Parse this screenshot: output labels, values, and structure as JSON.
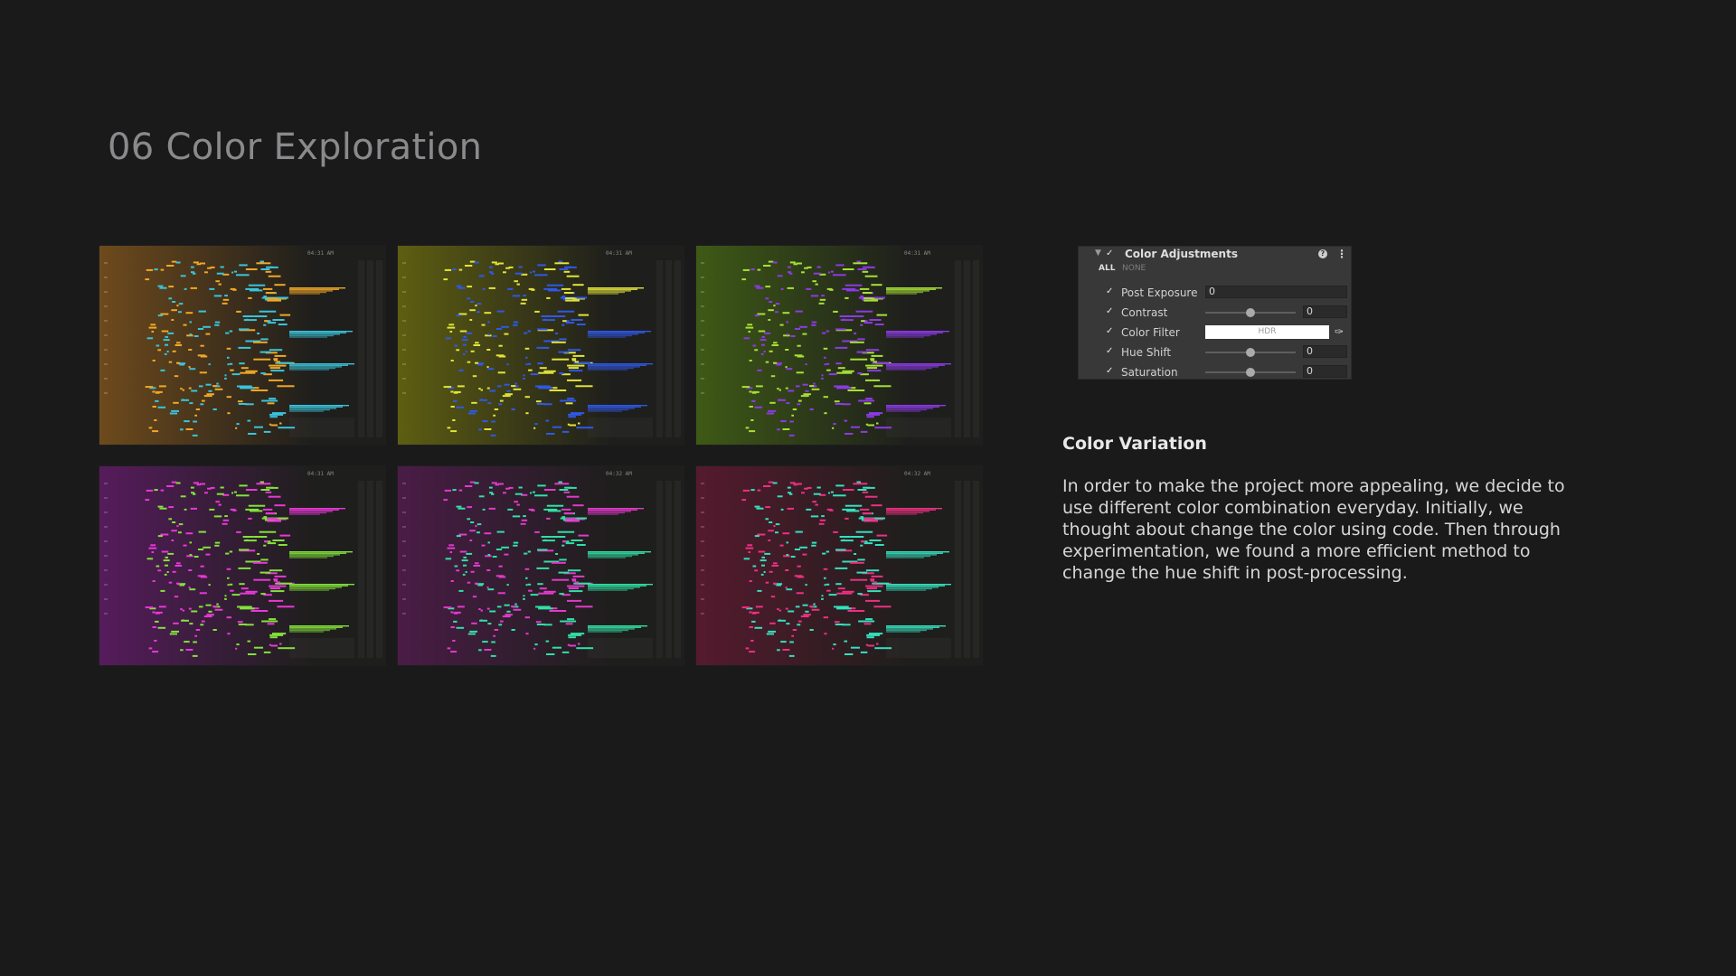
{
  "page": {
    "title": "06 Color Exploration"
  },
  "screenshots": [
    {
      "time": "04:31 AM",
      "bg_left": "#6e4a1c",
      "bg_right": "#1e1e1c",
      "color_a": "#f0a826",
      "color_b": "#39c4dc"
    },
    {
      "time": "04:31 AM",
      "bg_left": "#5e5e12",
      "bg_right": "#1e1e1c",
      "color_a": "#e2e43a",
      "color_b": "#2f58e6"
    },
    {
      "time": "04:31 AM",
      "bg_left": "#3e5a16",
      "bg_right": "#1e1e1c",
      "color_a": "#a8e036",
      "color_b": "#8c3ae6"
    },
    {
      "time": "04:31 AM",
      "bg_left": "#561c5c",
      "bg_right": "#1e1e1c",
      "color_a": "#e838d8",
      "color_b": "#82e23a"
    },
    {
      "time": "04:32 AM",
      "bg_left": "#4a1c46",
      "bg_right": "#1e1e1c",
      "color_a": "#e23acb",
      "color_b": "#30e0a6"
    },
    {
      "time": "04:32 AM",
      "bg_left": "#561a2e",
      "bg_right": "#1e1e1c",
      "color_a": "#ec3082",
      "color_b": "#34e0be"
    }
  ],
  "panel": {
    "title": "Color Adjustments",
    "all_label": "ALL",
    "none_label": "NONE",
    "rows": [
      {
        "label": "Post Exposure",
        "value": "0",
        "slider": false
      },
      {
        "label": "Contrast",
        "value": "0",
        "slider": true,
        "level": 0.5
      },
      {
        "label": "Color Filter",
        "swatch_text": "HDR",
        "swatch_color": "#ffffff"
      },
      {
        "label": "Hue Shift",
        "value": "0",
        "slider": true,
        "level": 0.5
      },
      {
        "label": "Saturation",
        "value": "0",
        "slider": true,
        "level": 0.5
      }
    ]
  },
  "article": {
    "heading": "Color Variation",
    "body": "In order to make the project more appealing, we decide to use different color combination everyday. Initially, we thought about change the color using code. Then through experimentation, we found a more efficient method to change the hue shift in post-processing."
  }
}
